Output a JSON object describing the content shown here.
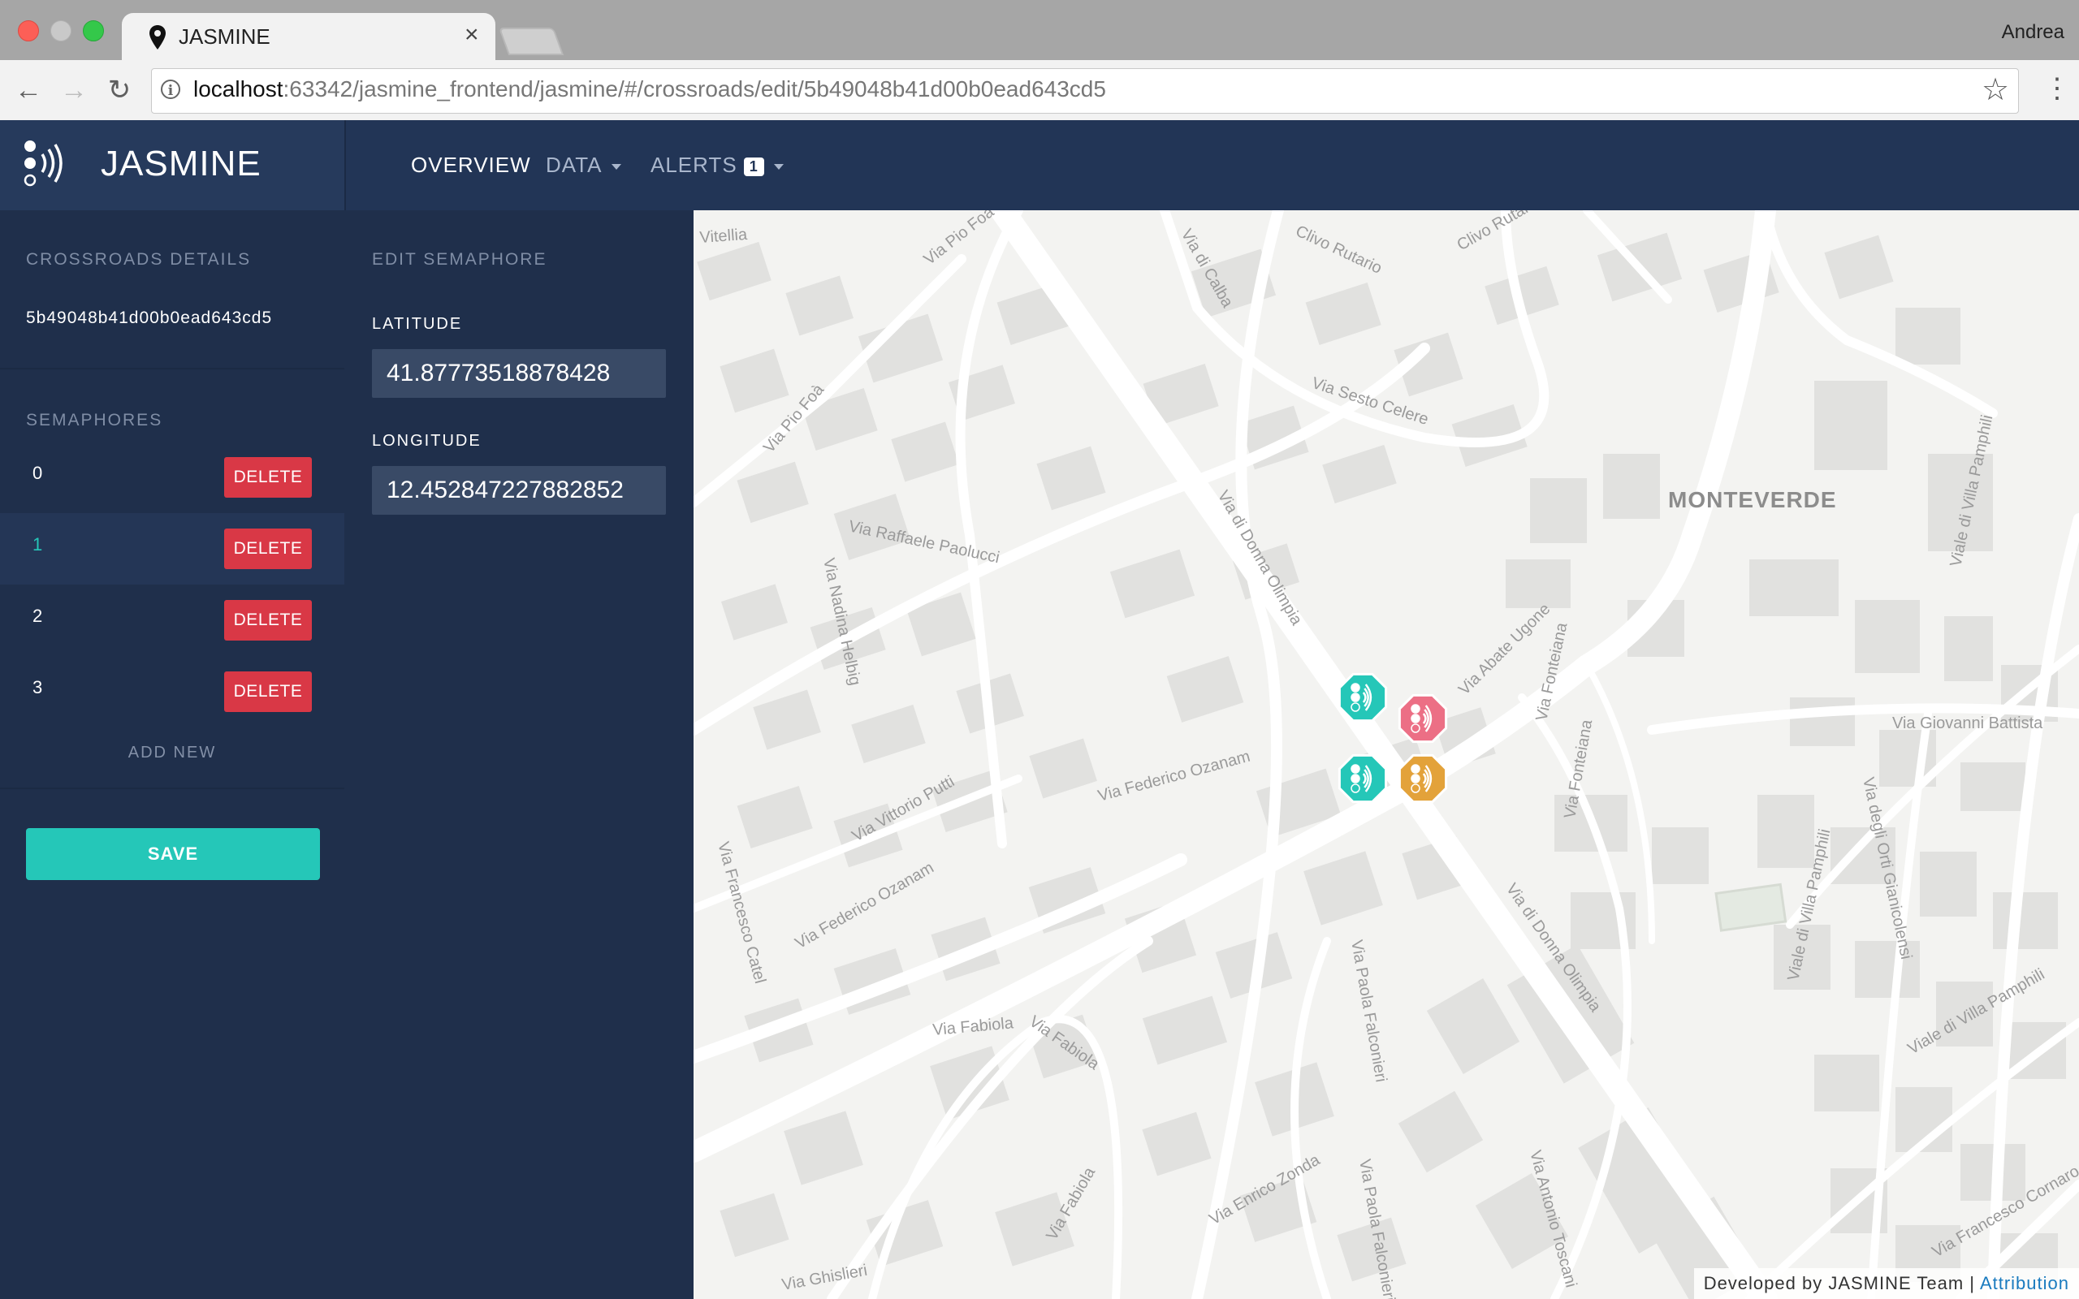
{
  "browser": {
    "tab_title": "JASMINE",
    "profile_name": "Andrea",
    "url_host": "localhost",
    "url_rest": ":63342/jasmine_frontend/jasmine/#/crossroads/edit/5b49048b41d00b0ead643cd5"
  },
  "navbar": {
    "brand": "JASMINE",
    "overview": "OVERVIEW",
    "data": "DATA",
    "alerts": "ALERTS",
    "alerts_count": "1"
  },
  "crossroads": {
    "heading": "CROSSROADS DETAILS",
    "id": "5b49048b41d00b0ead643cd5",
    "semaphores_heading": "SEMAPHORES",
    "semaphores": [
      {
        "label": "0",
        "delete": "DELETE"
      },
      {
        "label": "1",
        "delete": "DELETE",
        "active": true
      },
      {
        "label": "2",
        "delete": "DELETE"
      },
      {
        "label": "3",
        "delete": "DELETE"
      }
    ],
    "add_new": "ADD NEW",
    "save": "SAVE"
  },
  "edit": {
    "heading": "EDIT SEMAPHORE",
    "latitude_label": "LATITUDE",
    "latitude_value": "41.87773518878428",
    "longitude_label": "LONGITUDE",
    "longitude_value": "12.452847227882852"
  },
  "map": {
    "district": "MONTEVERDE",
    "streets": [
      "Vitellia",
      "Via Pio Foà",
      "Via di Calba",
      "Clivo Rutario",
      "Clivo Rutario",
      "Via Sesto Celere",
      "Via Pio Foà",
      "Via Raffaele Paolucci",
      "Via di Donna Olimpia",
      "Via Abate Ugone",
      "Via Fonteiana",
      "Via Fonteiana",
      "Via Nadina Helbig",
      "Via Federico Ozanam",
      "Via Federico Ozanam",
      "Via Vittorio Putti",
      "Via Francesco Catel",
      "Via Giovanni Battista",
      "Via di Donna Olimpia",
      "Via Paola Falconieri",
      "Via Fabiola",
      "Via Fabiola",
      "Via Fabiola",
      "Via Enrico Zonda",
      "Via Paola Falconieri",
      "Via Antonio Toscani",
      "Via Francesco Cornaro",
      "Viale di Villa Pamphili",
      "Viale di Villa Pamphili",
      "Via degli Orti Gianicolensi",
      "Via Ghislieri",
      "Viale di Villa Pamphili"
    ],
    "markers": [
      {
        "name": "semaphore-marker-0",
        "color": "#25c7b8"
      },
      {
        "name": "semaphore-marker-1",
        "color": "#ec6f85"
      },
      {
        "name": "semaphore-marker-2",
        "color": "#25c7b8"
      },
      {
        "name": "semaphore-marker-3",
        "color": "#e3a23a"
      }
    ],
    "footer_text": "Developed by JASMINE Team |",
    "attribution": "Attribution"
  },
  "colors": {
    "accent": "#25c7b8",
    "danger": "#d93846",
    "navbar": "#223556",
    "sidebar": "#1f2f4b"
  }
}
